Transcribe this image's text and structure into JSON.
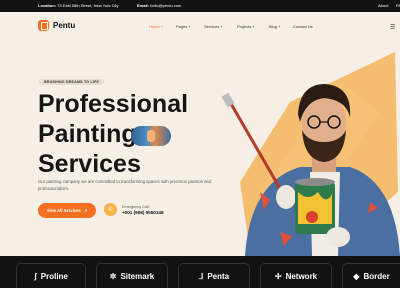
{
  "topbar": {
    "location_label": "Location:",
    "location_value": "73 East 58th Street, New York City",
    "email_label": "Email:",
    "email_value": "hello@pentu.com",
    "about": "About",
    "more": "FA"
  },
  "brand": {
    "name": "Pentu"
  },
  "nav": {
    "items": [
      {
        "label": "Home +"
      },
      {
        "label": "Pages +"
      },
      {
        "label": "Services +"
      },
      {
        "label": "Projects +"
      },
      {
        "label": "Blog +"
      },
      {
        "label": "Contact Us"
      }
    ]
  },
  "hero": {
    "tag": "BRUSHING DREAMS TO LIFE",
    "line1": "Professional",
    "line2": "Painting",
    "line3": "Services",
    "description": "Our painting company we are committed to transforming spaces with precision passion and professionalism.",
    "cta": "View All Services",
    "cta_icon": "↗",
    "call_label": "Emergency Call:",
    "call_number": "+001 (908) 5550148"
  },
  "brands": [
    {
      "name": "Proline",
      "icon": "ʃ"
    },
    {
      "name": "Sitemark",
      "icon": "✲"
    },
    {
      "name": "Penta",
      "icon": "⅃"
    },
    {
      "name": "Network",
      "icon": "✢"
    },
    {
      "name": "Border",
      "icon": "◆"
    }
  ],
  "colors": {
    "accent": "#f37021",
    "dark": "#121212",
    "bg": "#f5efe6"
  }
}
